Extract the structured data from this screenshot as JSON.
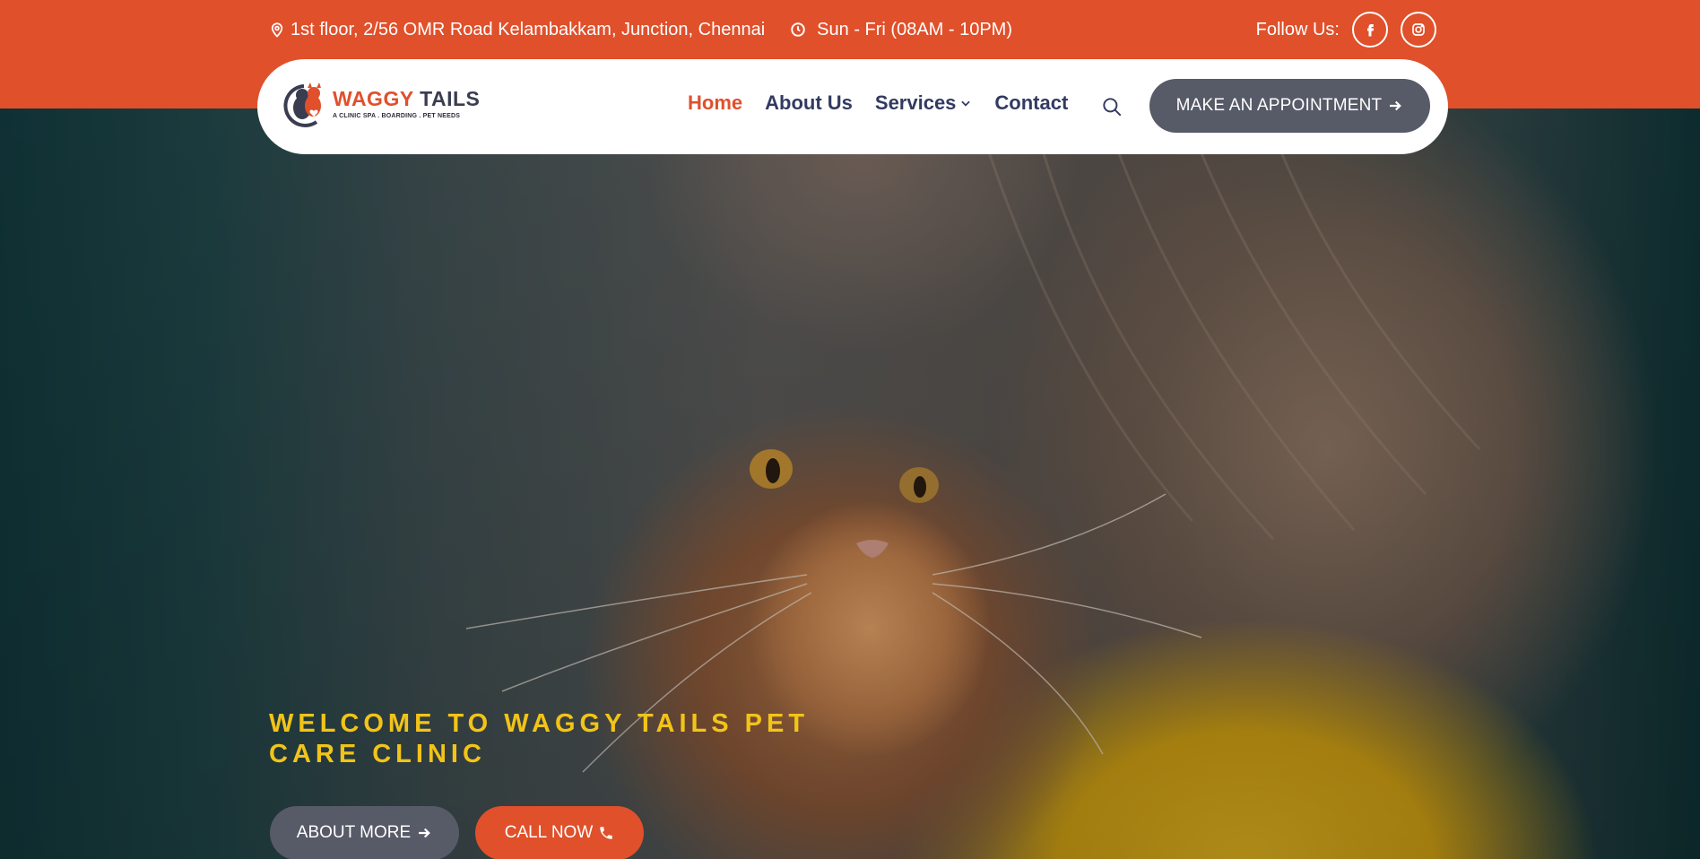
{
  "colors": {
    "brand": "#e0502b",
    "nav_text": "#333a61",
    "button_dark": "#575a67",
    "welcome": "#f2c418"
  },
  "topbar": {
    "address": "1st floor, 2/56 OMR Road Kelambakkam, Junction, Chennai",
    "address_icon": "map-pin-icon",
    "hours": "Sun - Fri (08AM - 10PM)",
    "hours_icon": "clock-icon",
    "follow_label": "Follow Us:",
    "socials": [
      "facebook-icon",
      "instagram-icon"
    ]
  },
  "logo": {
    "title_part1": "WAGGY",
    "title_part2": "TAILS",
    "subtitle": "A CLINIC SPA . BOARDING . PET NEEDS"
  },
  "nav": {
    "items": [
      {
        "label": "Home",
        "active": true
      },
      {
        "label": "About Us"
      },
      {
        "label": "Services",
        "dropdown": true
      },
      {
        "label": "Contact"
      }
    ],
    "search_icon": "search-icon",
    "cta_label": "MAKE AN APPOINTMENT"
  },
  "hero": {
    "welcome": "WELCOME TO WAGGY TAILS PET CARE CLINIC",
    "about_button": "ABOUT MORE",
    "call_button": "CALL NOW"
  }
}
